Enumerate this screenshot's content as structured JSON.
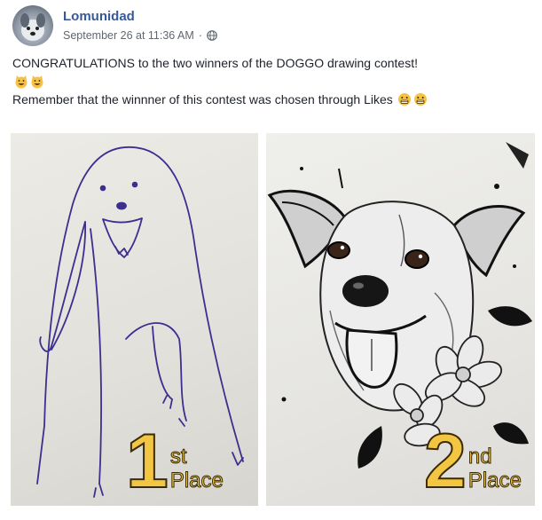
{
  "post": {
    "author": "Lomunidad",
    "timestamp": "September 26 at 11:36 AM",
    "separator": "·",
    "privacy_icon": "globe-icon",
    "line1": "CONGRATULATIONS to the two winners of the DOGGO drawing contest!",
    "line1_emojis": [
      "grinning-cat-emoji",
      "grinning-cat-emoji"
    ],
    "line2": "Remember that the winnner of this contest was chosen through Likes",
    "line2_emojis": [
      "grimacing-face-emoji",
      "grimacing-face-emoji"
    ]
  },
  "photos": [
    {
      "kind": "crude-dog-drawing",
      "place_number": "1",
      "place_suffix": "st",
      "place_word": "Place"
    },
    {
      "kind": "realistic-dog-drawing",
      "place_number": "2",
      "place_suffix": "nd",
      "place_word": "Place"
    }
  ],
  "colors": {
    "author": "#385898",
    "meta": "#616770",
    "text": "#1d2129",
    "badge": "#f2c542"
  }
}
